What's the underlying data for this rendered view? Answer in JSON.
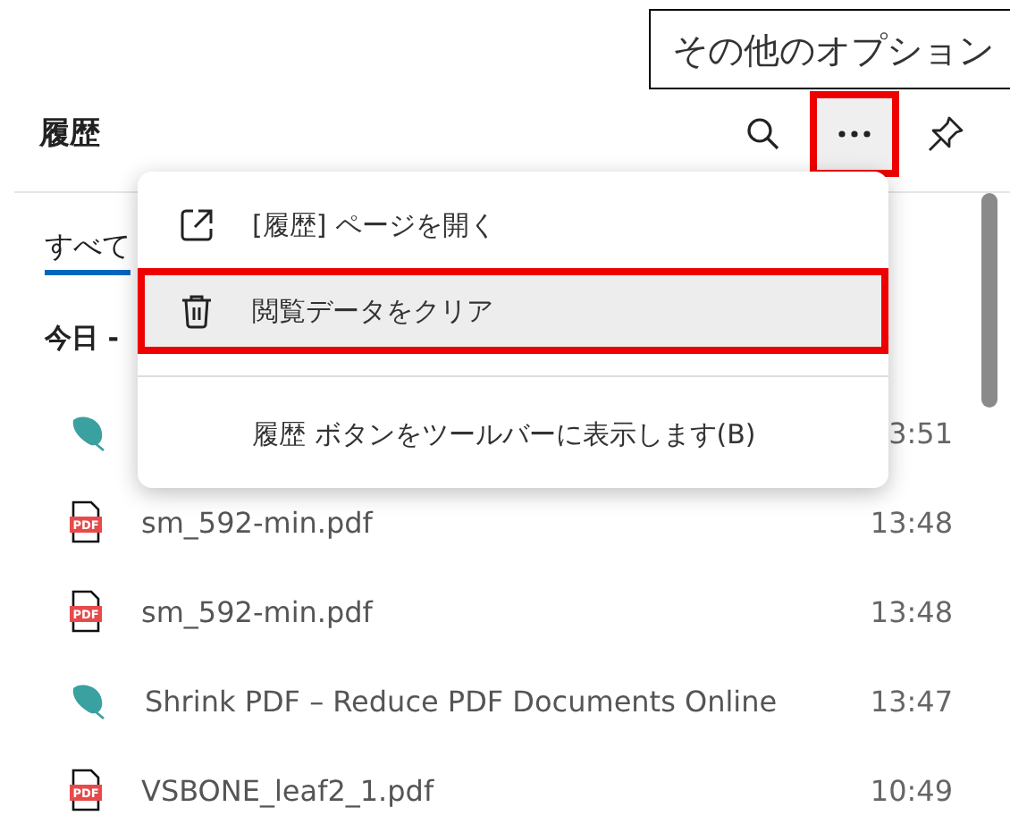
{
  "tooltip": "その他のオプション",
  "header": {
    "title": "履歴",
    "more_highlighted": true
  },
  "tabs": [
    {
      "label": "すべて",
      "selected": true
    }
  ],
  "section": "今日 -",
  "menu": [
    {
      "kind": "open",
      "label": "[履歴] ページを開く",
      "highlighted": false
    },
    {
      "kind": "clear",
      "label": "閲覧データをクリア",
      "highlighted": true
    },
    {
      "kind": "toolbar",
      "label": "履歴 ボタンをツールバーに表示します(B)",
      "highlighted": false
    }
  ],
  "rows": [
    {
      "kind": "site",
      "title": "",
      "time": "3:51"
    },
    {
      "kind": "pdf",
      "icon_label": "PDF",
      "title": "sm_592-min.pdf",
      "time": "13:48"
    },
    {
      "kind": "pdf",
      "icon_label": "PDF",
      "title": "sm_592-min.pdf",
      "time": "13:48"
    },
    {
      "kind": "site",
      "title": "Shrink PDF – Reduce PDF Documents Online",
      "time": "13:47"
    },
    {
      "kind": "pdf",
      "icon_label": "PDF",
      "title": "VSBONE_leaf2_1.pdf",
      "time": "10:49"
    }
  ]
}
